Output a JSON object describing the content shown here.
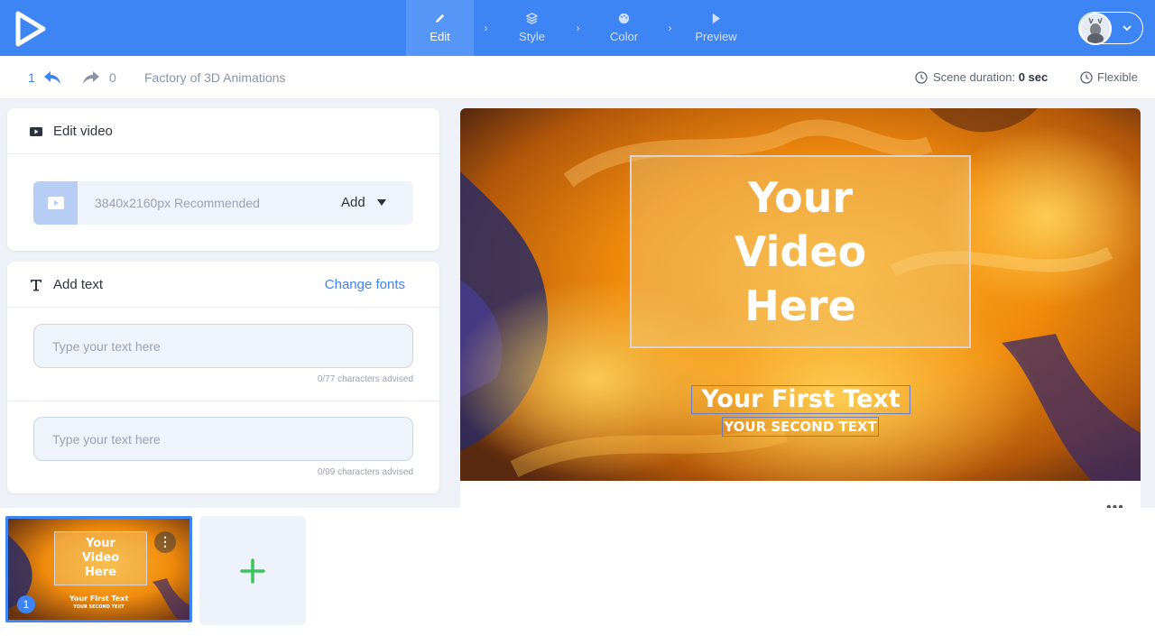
{
  "topbar": {
    "steps": [
      {
        "label": "Edit",
        "active": true,
        "icon": "pencil-icon"
      },
      {
        "label": "Style",
        "active": false,
        "icon": "layers-icon"
      },
      {
        "label": "Color",
        "active": false,
        "icon": "palette-icon"
      },
      {
        "label": "Preview",
        "active": false,
        "icon": "play-icon"
      }
    ],
    "separator": "›"
  },
  "subbar": {
    "undo_count": "1",
    "redo_count": "0",
    "project_title": "Factory of 3D Animations",
    "scene_duration_label": "Scene duration:",
    "scene_duration_value": "0 sec",
    "flexible_label": "Flexible"
  },
  "edit_video": {
    "title": "Edit video",
    "upload_hint": "3840x2160px Recommended",
    "add_label": "Add"
  },
  "add_text": {
    "title": "Add text",
    "change_fonts_label": "Change fonts",
    "fields": [
      {
        "placeholder": "Type your text here",
        "hint": "0/77 characters advised"
      },
      {
        "placeholder": "Type your text here",
        "hint": "0/99 characters advised"
      }
    ]
  },
  "preview": {
    "video_placeholder": "Your Video Here",
    "first_text": "Your First Text",
    "second_text": "YOUR SECOND TEXT",
    "more_label": "•••"
  },
  "scenes": {
    "thumbs": [
      {
        "number": "1",
        "video_placeholder": "Your Video Here",
        "first_text": "Your First Text",
        "second_text": "YOUR SECOND TEXT",
        "menu_label": "⋮"
      }
    ]
  },
  "colors": {
    "accent": "#3d85f5",
    "add_green": "#3ec25a"
  }
}
